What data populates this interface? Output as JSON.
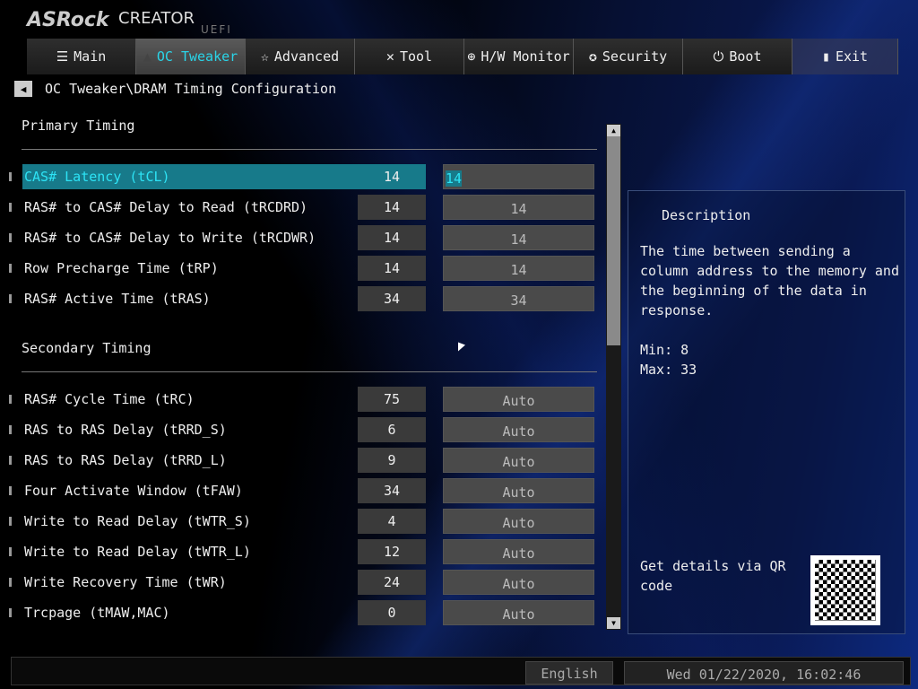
{
  "brand": {
    "logo": "ASRock",
    "product": "CREATOR",
    "uefi": "UEFI"
  },
  "tabs": [
    {
      "label": "Main",
      "icon": "list-icon"
    },
    {
      "label": "OC Tweaker",
      "icon": "rocket-icon"
    },
    {
      "label": "Advanced",
      "icon": "star-icon"
    },
    {
      "label": "Tool",
      "icon": "tools-icon"
    },
    {
      "label": "H/W Monitor",
      "icon": "crosshair-icon"
    },
    {
      "label": "Security",
      "icon": "badge-icon"
    },
    {
      "label": "Boot",
      "icon": "power-icon"
    },
    {
      "label": "Exit",
      "icon": "door-icon"
    }
  ],
  "active_tab": "OC Tweaker",
  "breadcrumb": "OC Tweaker\\DRAM Timing Configuration",
  "primary": {
    "title": "Primary Timing",
    "rows": [
      {
        "label": "CAS# Latency (tCL)",
        "value": "14",
        "setting": "14"
      },
      {
        "label": "RAS# to CAS# Delay to Read  (tRCDRD)",
        "value": "14",
        "setting": "14"
      },
      {
        "label": "RAS# to CAS# Delay to Write (tRCDWR)",
        "value": "14",
        "setting": "14"
      },
      {
        "label": "Row Precharge Time (tRP)",
        "value": "14",
        "setting": "14"
      },
      {
        "label": "RAS# Active Time (tRAS)",
        "value": "34",
        "setting": "34"
      }
    ]
  },
  "secondary": {
    "title": "Secondary Timing",
    "rows": [
      {
        "label": "RAS# Cycle Time (tRC)",
        "value": "75",
        "setting": "Auto"
      },
      {
        "label": "RAS to RAS Delay (tRRD_S)",
        "value": "6",
        "setting": "Auto"
      },
      {
        "label": "RAS to RAS Delay (tRRD_L)",
        "value": "9",
        "setting": "Auto"
      },
      {
        "label": "Four Activate Window (tFAW)",
        "value": "34",
        "setting": "Auto"
      },
      {
        "label": "Write to Read Delay (tWTR_S)",
        "value": "4",
        "setting": "Auto"
      },
      {
        "label": "Write to Read Delay (tWTR_L)",
        "value": "12",
        "setting": "Auto"
      },
      {
        "label": "Write Recovery Time (tWR)",
        "value": "24",
        "setting": "Auto"
      },
      {
        "label": "Trcpage (tMAW,MAC)",
        "value": "0",
        "setting": "Auto"
      }
    ]
  },
  "description": {
    "title": "Description",
    "text": "The time between sending a column address to the memory and the beginning of the data in response.",
    "min": "Min: 8",
    "max": "Max: 33",
    "qr_text": "Get details via QR code"
  },
  "footer": {
    "language": "English",
    "datetime": "Wed 01/22/2020, 16:02:46"
  },
  "colors": {
    "accent": "#2de3f5",
    "selected_row": "#177a8a"
  }
}
